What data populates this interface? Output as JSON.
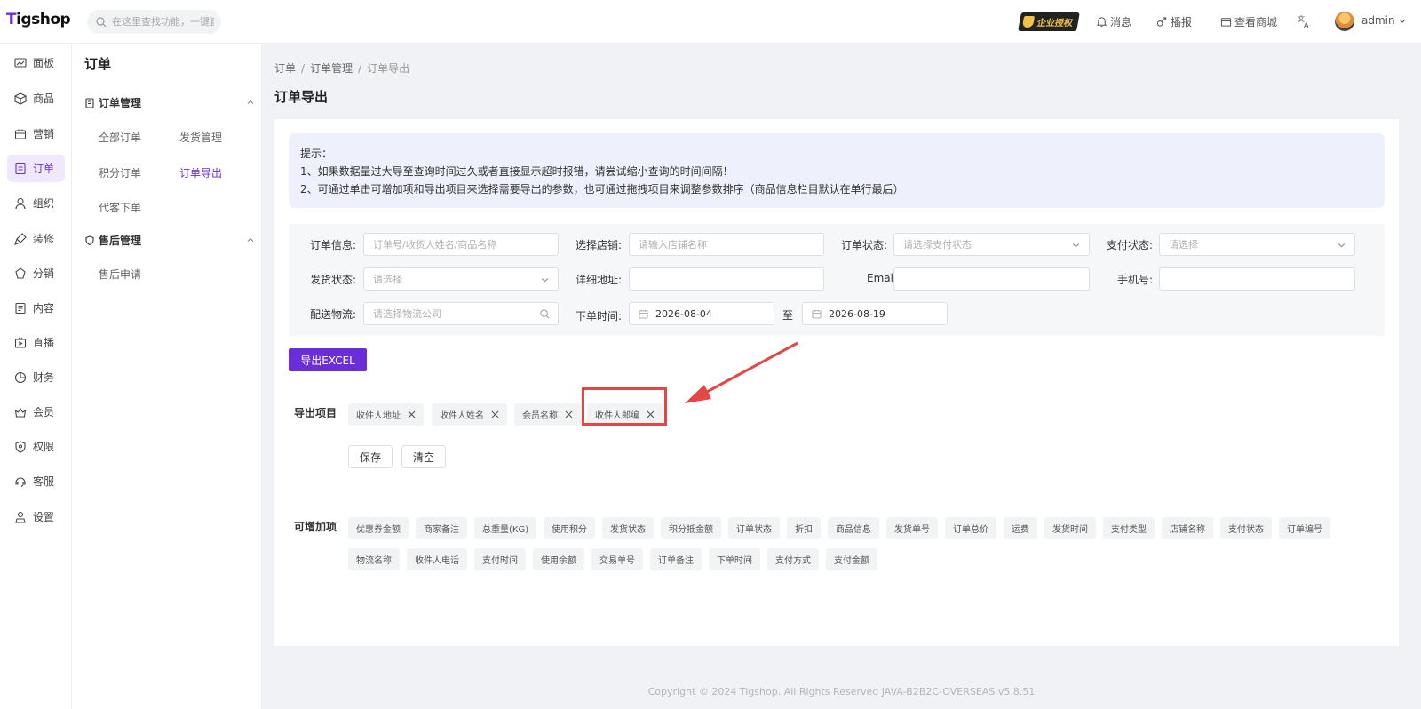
{
  "header": {
    "logo_text": "Tigshop",
    "search_placeholder": "在这里查找功能，一键直达",
    "enterprise_badge": "企业授权",
    "messages": "消息",
    "broadcast": "播报",
    "view_store": "查看商城",
    "user": "admin"
  },
  "rail": [
    {
      "label": "面板",
      "icon": "dashboard-icon"
    },
    {
      "label": "商品",
      "icon": "box-icon"
    },
    {
      "label": "营销",
      "icon": "marketing-icon"
    },
    {
      "label": "订单",
      "icon": "order-icon",
      "active": true
    },
    {
      "label": "组织",
      "icon": "org-icon"
    },
    {
      "label": "装修",
      "icon": "brush-icon"
    },
    {
      "label": "分销",
      "icon": "distribution-icon"
    },
    {
      "label": "内容",
      "icon": "content-icon"
    },
    {
      "label": "直播",
      "icon": "live-icon"
    },
    {
      "label": "财务",
      "icon": "finance-icon"
    },
    {
      "label": "会员",
      "icon": "member-icon"
    },
    {
      "label": "权限",
      "icon": "shield-icon"
    },
    {
      "label": "客服",
      "icon": "service-icon"
    },
    {
      "label": "设置",
      "icon": "settings-icon"
    }
  ],
  "subnav": {
    "title": "订单",
    "groups": [
      {
        "title": "订单管理",
        "links": [
          "全部订单",
          "发货管理",
          "积分订单",
          "订单导出",
          "代客下单"
        ]
      },
      {
        "title": "售后管理",
        "links": [
          "售后申请"
        ]
      }
    ]
  },
  "breadcrumb": [
    "订单",
    "订单管理",
    "订单导出"
  ],
  "page_title": "订单导出",
  "tip": {
    "line0": "提示：",
    "line1": "1、如果数据量过大导至查询时间过久或者直接显示超时报错，请尝试缩小查询的时间间隔！",
    "line2": "2、可通过单击可增加项和导出项目来选择需要导出的参数，也可通过拖拽项目来调整参数排序（商品信息栏目默认在单行最后）"
  },
  "filters": {
    "order_info": {
      "label": "订单信息:",
      "placeholder": "订单号/收货人姓名/商品名称"
    },
    "store": {
      "label": "选择店铺:",
      "placeholder": "请输入店铺名称"
    },
    "order_status": {
      "label": "订单状态:",
      "placeholder": "请选择支付状态"
    },
    "pay_status": {
      "label": "支付状态:",
      "placeholder": "请选择"
    },
    "ship_status": {
      "label": "发货状态:",
      "placeholder": "请选择"
    },
    "address": {
      "label": "详细地址:",
      "placeholder": ""
    },
    "email": {
      "label": "Email:",
      "placeholder": ""
    },
    "phone": {
      "label": "手机号:",
      "placeholder": ""
    },
    "logistics": {
      "label": "配送物流:",
      "placeholder": "请选择物流公司"
    },
    "order_time": {
      "label": "下单时间:",
      "start": "2026-08-04",
      "sep": "至",
      "end": "2026-08-19"
    }
  },
  "export_button": "导出EXCEL",
  "export_items": {
    "label": "导出项目",
    "tags": [
      "收件人地址",
      "收件人姓名",
      "会员名称",
      "收件人邮编"
    ]
  },
  "save_button": "保存",
  "clear_button": "清空",
  "addable": {
    "label": "可增加项",
    "row1": [
      "优惠券金额",
      "商家备注",
      "总重量(KG)",
      "使用积分",
      "发货状态",
      "积分抵金额",
      "订单状态",
      "折扣",
      "商品信息",
      "发货单号",
      "订单总价",
      "运费",
      "发货时间",
      "支付类型",
      "店铺名称",
      "支付状态",
      "订单编号"
    ],
    "row2": [
      "物流名称",
      "收件人电话",
      "支付时间",
      "使用余额",
      "交易单号",
      "订单备注",
      "下单时间",
      "支付方式",
      "支付金额"
    ]
  },
  "footer": "Copyright © 2024 Tigshop. All Rights Reserved JAVA-B2B2C-OVERSEAS v5.8.51",
  "colors": {
    "accent": "#6a2ed8",
    "highlight": "#e64545"
  }
}
